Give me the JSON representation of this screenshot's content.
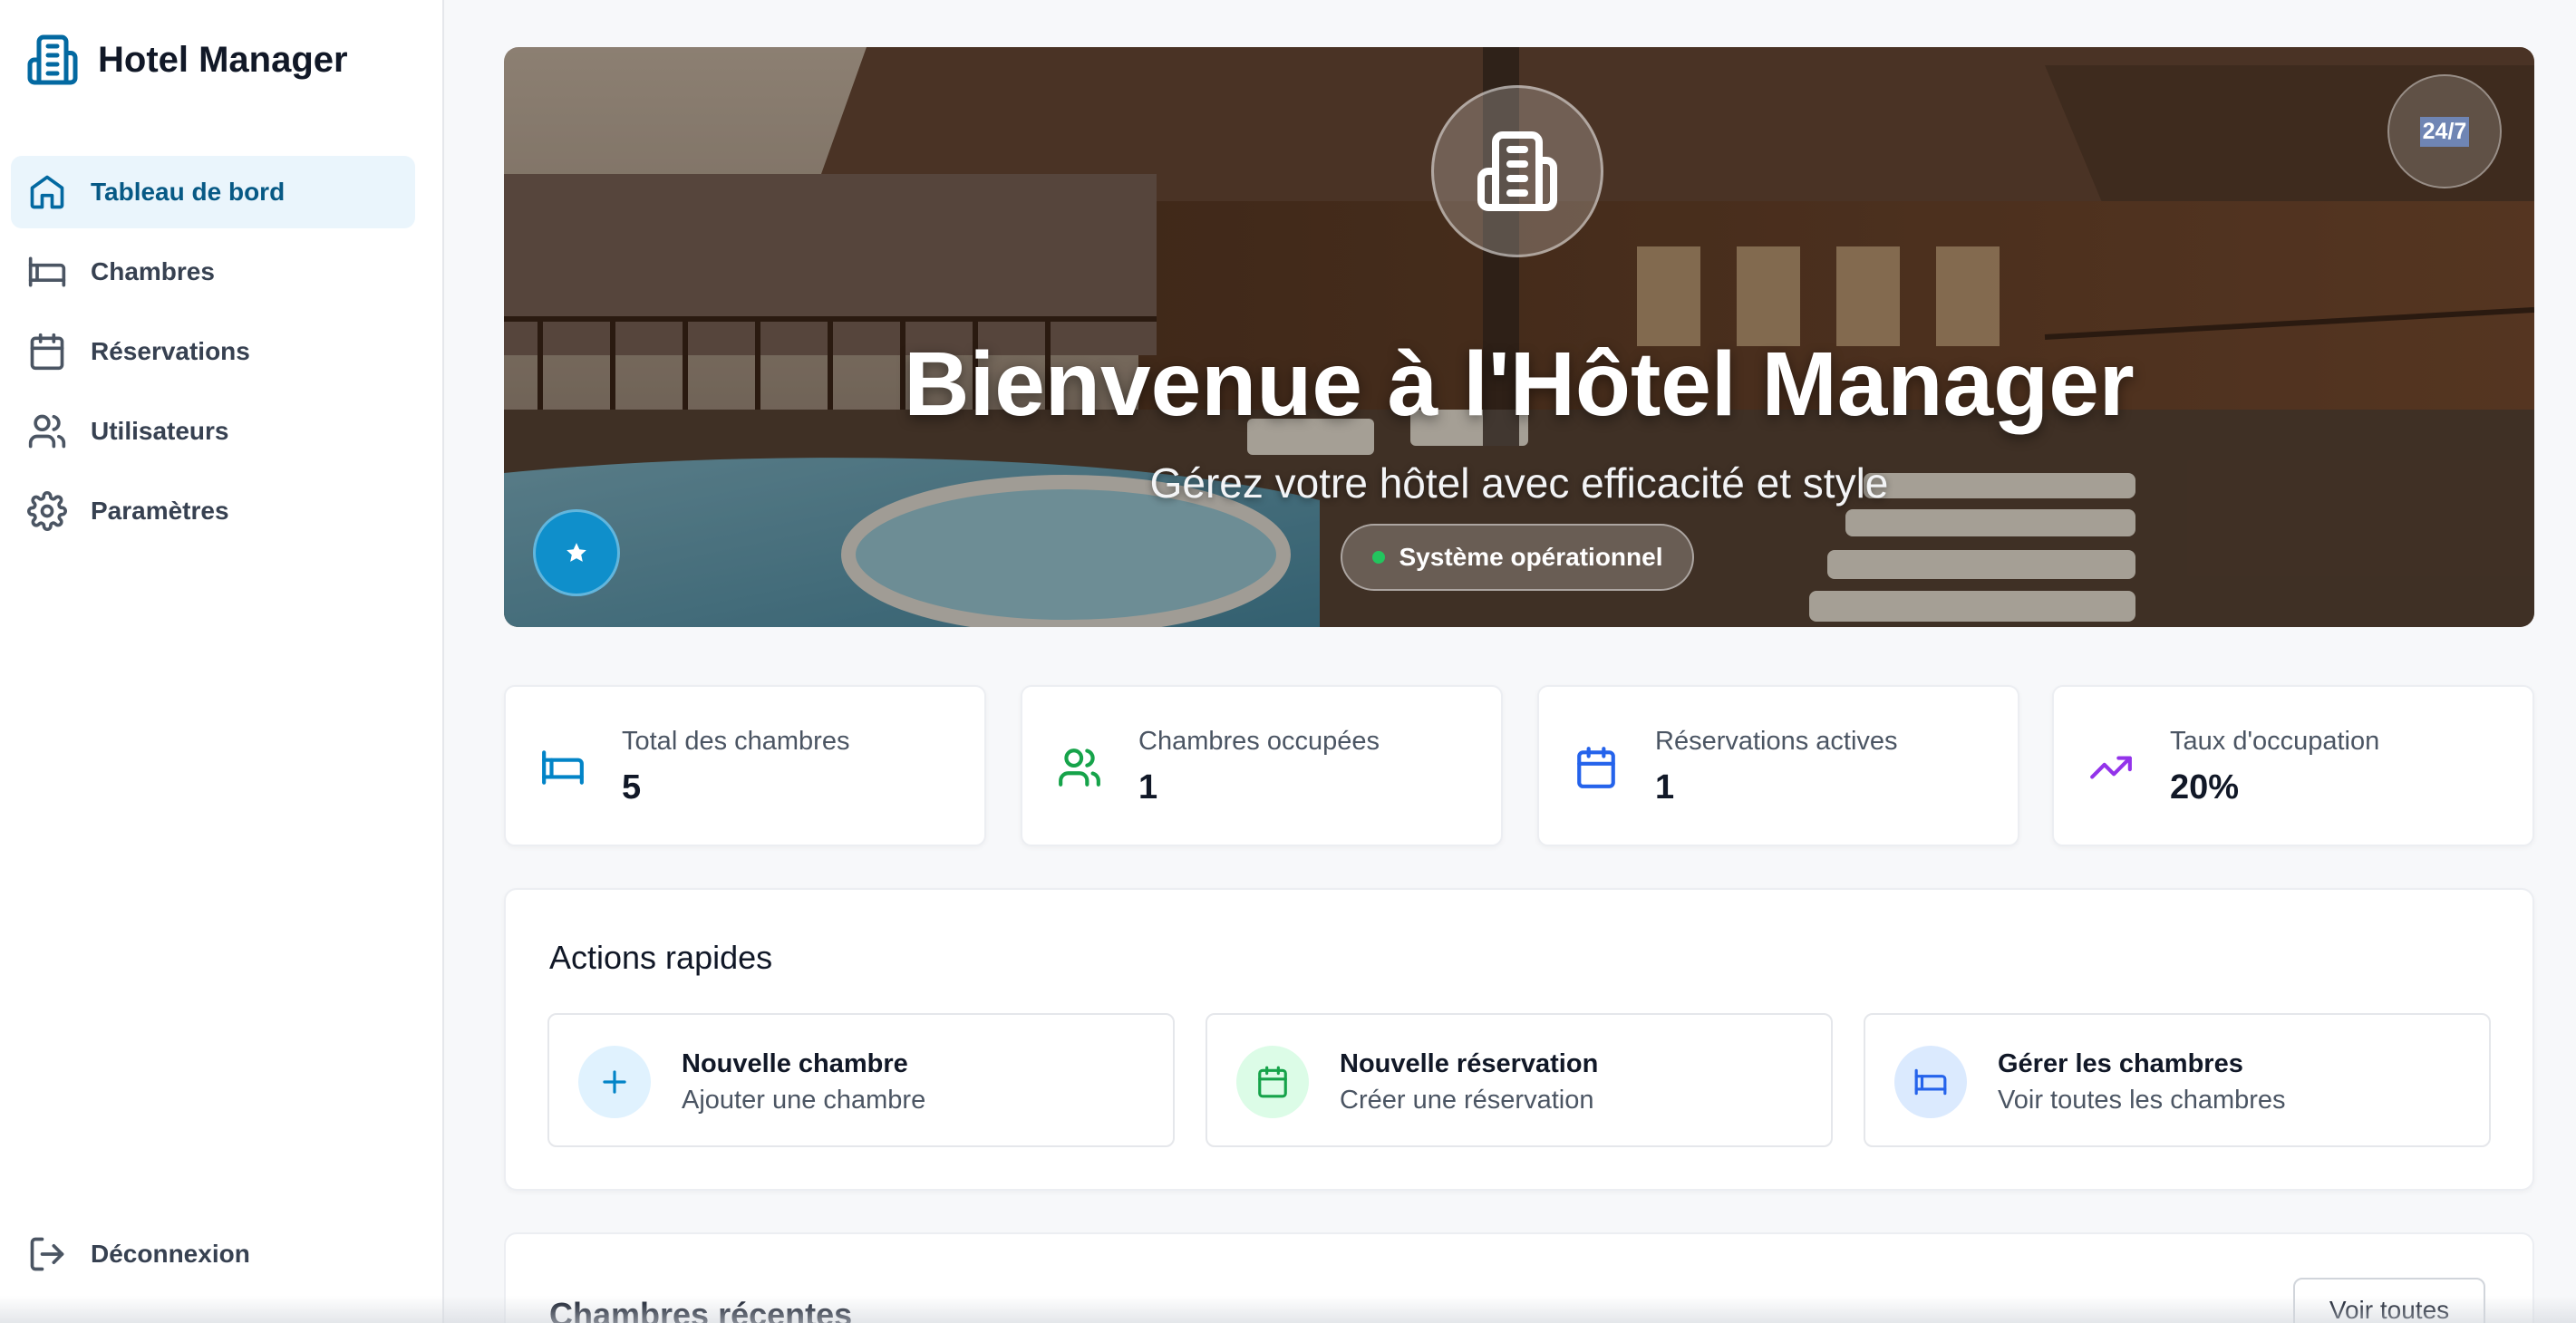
{
  "app": {
    "title": "Hotel Manager"
  },
  "sidebar": {
    "items": [
      {
        "label": "Tableau de bord",
        "icon": "home-icon",
        "active": true
      },
      {
        "label": "Chambres",
        "icon": "bed-icon",
        "active": false
      },
      {
        "label": "Réservations",
        "icon": "calendar-icon",
        "active": false
      },
      {
        "label": "Utilisateurs",
        "icon": "users-icon",
        "active": false
      },
      {
        "label": "Paramètres",
        "icon": "gear-icon",
        "active": false
      }
    ],
    "logout_label": "Déconnexion"
  },
  "hero": {
    "title": "Bienvenue à l'Hôtel Manager",
    "subtitle": "Gérez votre hôtel avec efficacité et style",
    "badge": "24/7",
    "status": "Système opérationnel",
    "status_color": "#22c55e"
  },
  "stats": [
    {
      "label": "Total des chambres",
      "value": "5",
      "icon": "bed-icon",
      "color": "#0284c7"
    },
    {
      "label": "Chambres occupées",
      "value": "1",
      "icon": "users-icon",
      "color": "#16a34a"
    },
    {
      "label": "Réservations actives",
      "value": "1",
      "icon": "calendar-icon",
      "color": "#2563eb"
    },
    {
      "label": "Taux d'occupation",
      "value": "20%",
      "icon": "trending-up-icon",
      "color": "#9333ea"
    }
  ],
  "quick_actions": {
    "title": "Actions rapides",
    "items": [
      {
        "title": "Nouvelle chambre",
        "subtitle": "Ajouter une chambre",
        "icon": "plus-icon"
      },
      {
        "title": "Nouvelle réservation",
        "subtitle": "Créer une réservation",
        "icon": "calendar-icon"
      },
      {
        "title": "Gérer les chambres",
        "subtitle": "Voir toutes les chambres",
        "icon": "bed-icon"
      }
    ]
  },
  "recent_rooms": {
    "title": "Chambres récentes",
    "see_all_label": "Voir toutes"
  },
  "colors": {
    "accent": "#0369a1",
    "active_bg": "#eaf5fc",
    "star_button": "#0f8fcb"
  }
}
